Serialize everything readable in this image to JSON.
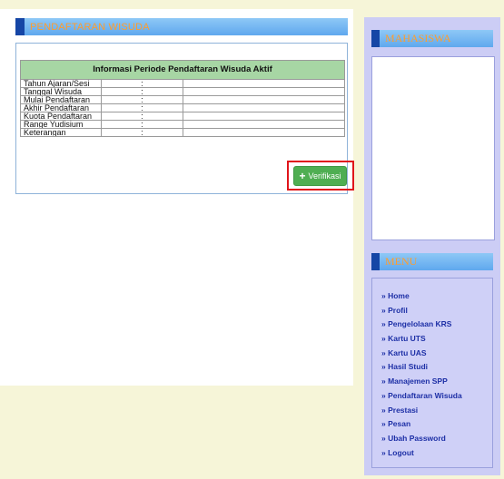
{
  "page": {
    "title": "PENDAFTARAN WISUDA"
  },
  "info_table": {
    "heading": "Informasi Periode Pendaftaran Wisuda Aktif",
    "rows": [
      {
        "label": "Tahun Ajaran/Sesi",
        "sep": ":",
        "value": ""
      },
      {
        "label": "Tanggal Wisuda",
        "sep": ":",
        "value": ""
      },
      {
        "label": "Mulai Pendaftaran",
        "sep": ":",
        "value": ""
      },
      {
        "label": "Akhir Pendaftaran",
        "sep": ":",
        "value": ""
      },
      {
        "label": "Kuota Pendaftaran",
        "sep": ":",
        "value": ""
      },
      {
        "label": "Range Yudisium",
        "sep": ":",
        "value": ""
      },
      {
        "label": "Keterangan",
        "sep": ":",
        "value": ""
      }
    ]
  },
  "verify_button": {
    "icon": "plus-icon",
    "plus": "+",
    "label": "Verifikasi"
  },
  "sidebar": {
    "mahasiswa_title": "MAHASISWA",
    "menu_title": "MENU",
    "menu_items": [
      "» Home",
      "» Profil",
      "» Pengelolaan KRS",
      "» Kartu UTS",
      "» Kartu UAS",
      "» Hasil Studi",
      "» Manajemen SPP",
      "» Pendaftaran Wisuda",
      "» Prestasi",
      "» Pesan",
      "» Ubah Password",
      "» Logout"
    ]
  },
  "colors": {
    "page_bg": "#f6f5d8",
    "title_bar": "#5fa8ee",
    "title_accent": "#1546a6",
    "title_text": "#ff9d2e",
    "table_header": "#a7d6a4",
    "button": "#4fae52",
    "highlight": "#e0151b",
    "sidebar_bg": "#cccdf5",
    "menu_link": "#1d2fa6"
  }
}
